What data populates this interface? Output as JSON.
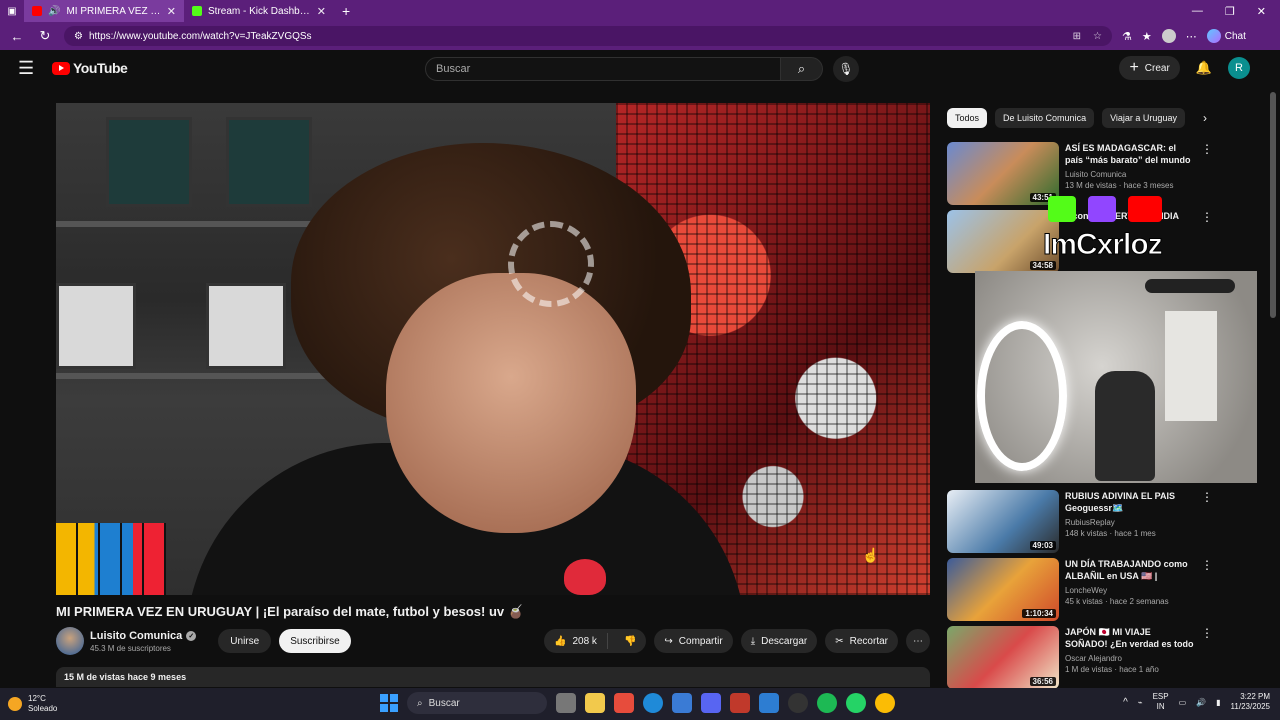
{
  "browser": {
    "tabs": [
      {
        "label": "MI PRIMERA VEZ EN URUGUAY | ¡El paraíso del mate, futbol y besos! uv",
        "active": true
      },
      {
        "label": "Stream - Kick Dashboard",
        "active": false
      }
    ],
    "url": "https://www.youtube.com/watch?v=JTeakZVGQSs",
    "chat_label": "Chat"
  },
  "youtube": {
    "logo_text": "YouTube",
    "search_placeholder": "Buscar",
    "create_label": "Crear",
    "avatar_letter": "R"
  },
  "video": {
    "title": "MI PRIMERA VEZ EN URUGUAY | ¡El paraíso del mate, futbol y besos! uv 🧉",
    "channel_name": "Luisito Comunica",
    "subscribers": "45.3 M de suscriptores",
    "join_label": "Unirse",
    "subscribe_label": "Suscribirse",
    "likes": "208 k",
    "share_label": "Compartir",
    "download_label": "Descargar",
    "clip_label": "Recortar",
    "description_meta": "15 M de vistas  hace 9 meses"
  },
  "sidebar": {
    "chips": [
      "Todos",
      "De Luisito Comunica",
      "Viajar a Uruguay"
    ],
    "recommendations": [
      {
        "title": "ASÍ ES MADAGASCAR: el país “más barato” del mundo | ...",
        "channel": "Luisito Comunica",
        "meta": "13 M de vistas · hace 3 meses",
        "duration": "43:51"
      },
      {
        "title": "...con ... MUERTE en INDIA",
        "channel": "",
        "meta": "",
        "duration": "34:58"
      },
      {
        "title": "RUBIUS ADIVINA EL PAIS Geoguessr🗺️",
        "channel": "RubiusReplay",
        "meta": "148 k vistas · hace 1 mes",
        "duration": "49:03"
      },
      {
        "title": "UN DÍA TRABAJANDO como ALBAÑIL en USA 🇺🇸 | CUANTO ...",
        "channel": "LoncheWey",
        "meta": "45 k vistas · hace 2 semanas",
        "duration": "1:10:34"
      },
      {
        "title": "JAPÓN 🇯🇵 MI VIAJE SOÑADO! ¿En verdad es todo lo que ...",
        "channel": "Oscar Alejandro",
        "meta": "1 M de vistas · hace 1 año",
        "duration": "36:56"
      }
    ]
  },
  "overlay": {
    "streamer_name": "ImCxrloz"
  },
  "taskbar": {
    "temperature": "12°C",
    "weather": "Soleado",
    "search_label": "Buscar",
    "lang1": "ESP",
    "lang2": "IN",
    "time": "3:22 PM",
    "date": "11/23/2025"
  },
  "colors": {
    "browser_frame": "#5b1f7a",
    "yt_background": "#0f0f0f",
    "yt_red": "#ff0000"
  }
}
